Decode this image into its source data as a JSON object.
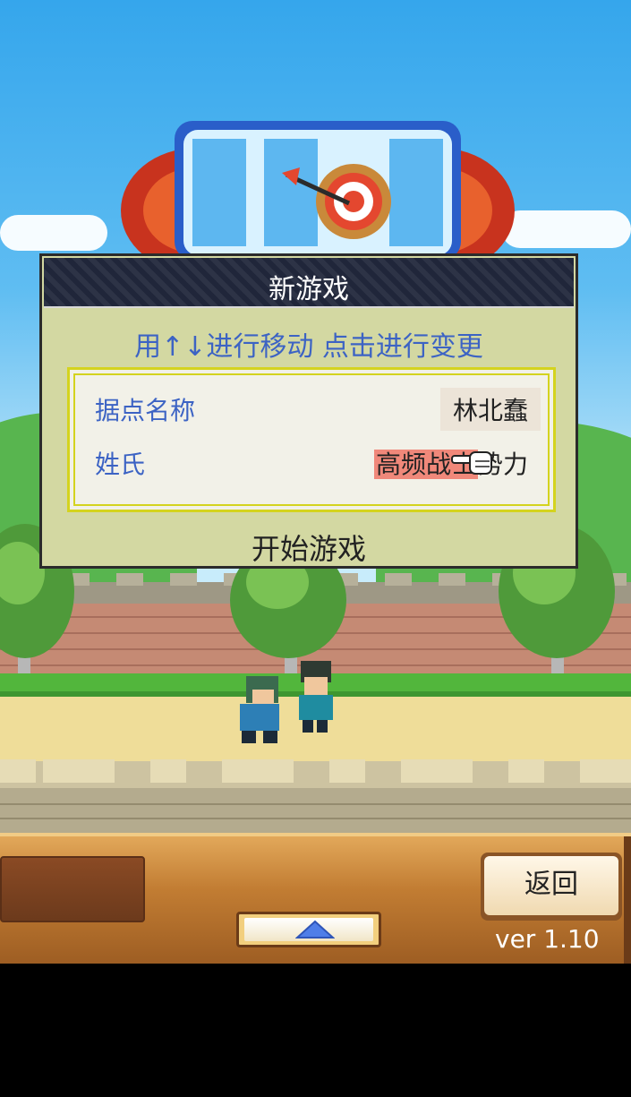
{
  "dialog": {
    "title": "新游戏",
    "instruction": "用↑↓进行移动 点击进行变更",
    "rows": [
      {
        "label": "据点名称",
        "value": "林北蠢"
      },
      {
        "label": "姓氏",
        "value_highlight": "高频战士",
        "value_tail": "势力"
      }
    ],
    "start_label": "开始游戏"
  },
  "footer": {
    "back_label": "返回",
    "version": "ver 1.10"
  },
  "colors": {
    "panel": "#d3d8a2",
    "accent_text": "#3c63c4",
    "highlight": "#f0887a"
  }
}
